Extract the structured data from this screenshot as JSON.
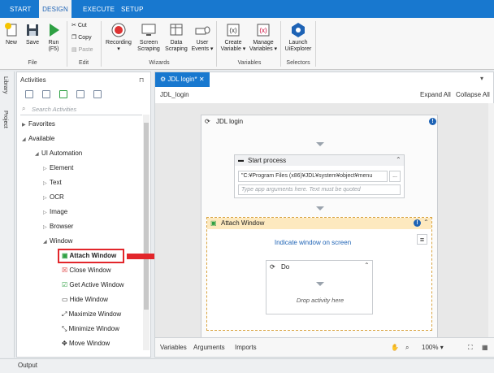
{
  "ribbon_tabs": [
    "START",
    "DESIGN",
    "EXECUTE",
    "SETUP"
  ],
  "ribbon": {
    "file": {
      "new": "New",
      "save": "Save",
      "run": "Run",
      "run_key": "(F5)",
      "group": "File"
    },
    "edit": {
      "cut": "Cut",
      "copy": "Copy",
      "paste": "Paste",
      "group": "Edit"
    },
    "wizards": {
      "recording": "Recording",
      "screen": "Screen",
      "screen2": "Scraping",
      "data": "Data",
      "data2": "Scraping",
      "user": "User",
      "user2": "Events",
      "group": "Wizards"
    },
    "variables": {
      "create": "Create",
      "create2": "Variable",
      "manage": "Manage",
      "manage2": "Variables",
      "group": "Variables"
    },
    "selectors": {
      "launch": "Launch",
      "launch2": "UiExplorer",
      "group": "Selectors"
    }
  },
  "side_tabs": [
    "Library",
    "Project"
  ],
  "activities": {
    "title": "Activities",
    "search_placeholder": "Search Activities",
    "tree": {
      "favorites": "Favorites",
      "available": "Available",
      "ui_automation": "UI Automation",
      "element": "Element",
      "text": "Text",
      "ocr": "OCR",
      "image": "Image",
      "browser": "Browser",
      "window": "Window",
      "attach_window": "Attach Window",
      "close_window": "Close Window",
      "get_active_window": "Get Active Window",
      "hide_window": "Hide Window",
      "maximize_window": "Maximize Window",
      "minimize_window": "Minimize Window",
      "move_window": "Move Window"
    }
  },
  "designer": {
    "doc_tab": "JDL login*",
    "breadcrumb": "JDL_login",
    "expand_all": "Expand All",
    "collapse_all": "Collapse All",
    "sequence_title": "JDL login",
    "start_process": "Start process",
    "path_value": "\"C:¥Program Files (x86)¥JDL¥system¥object¥menu",
    "args_placeholder": "Type app arguments here. Text must be quoted",
    "attach_title": "Attach Window",
    "indicate": "Indicate window on screen",
    "do_title": "Do",
    "drop_here": "Drop activity here",
    "ellipsis": "..."
  },
  "bottom_bar": {
    "variables": "Variables",
    "arguments": "Arguments",
    "imports": "Imports",
    "zoom": "100%"
  },
  "output": "Output",
  "colors": {
    "accent": "#1878cf",
    "highlight": "#e2262b",
    "attach_header": "#fde9bf"
  }
}
